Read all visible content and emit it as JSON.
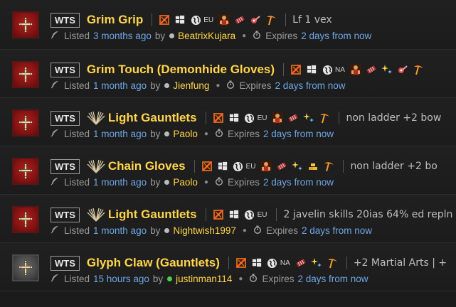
{
  "listings": [
    {
      "badge": "WTS",
      "title": "Grim Grip",
      "has_wings": false,
      "thumb": "red",
      "region": "EU",
      "icons": [
        "ladder-slash-icon",
        "windows-icon",
        "globe-icon",
        "character-icon",
        "ethereal-icon",
        "socket-icon",
        "pickaxe-icon"
      ],
      "note": "Lf 1 vex",
      "listed_label": "Listed",
      "listed_time": "3 months ago",
      "by_label": "by",
      "user": "BeatrixKujara",
      "user_online": false,
      "expires_label": "Expires",
      "expires_time": "2 days from now"
    },
    {
      "badge": "WTS",
      "title": "Grim Touch (Demonhide Gloves)",
      "has_wings": false,
      "thumb": "red",
      "region": "NA",
      "icons": [
        "ladder-slash-icon",
        "windows-icon",
        "globe-icon",
        "character-icon",
        "ethereal-icon",
        "sparkle-icon",
        "socket-icon",
        "pickaxe-icon"
      ],
      "note": "",
      "listed_label": "Listed",
      "listed_time": "1 month ago",
      "by_label": "by",
      "user": "Jienfung",
      "user_online": false,
      "expires_label": "Expires",
      "expires_time": "2 days from now"
    },
    {
      "badge": "WTS",
      "title": "Light Gauntlets",
      "has_wings": true,
      "thumb": "red",
      "region": "EU",
      "icons": [
        "ladder-slash-icon",
        "windows-icon",
        "globe-icon",
        "character-icon",
        "ethereal-icon",
        "sparkle-icon",
        "pickaxe-icon"
      ],
      "note": "non ladder +2 bow",
      "listed_label": "Listed",
      "listed_time": "1 month ago",
      "by_label": "by",
      "user": "Paolo",
      "user_online": false,
      "expires_label": "Expires",
      "expires_time": "2 days from now"
    },
    {
      "badge": "WTS",
      "title": "Chain Gloves",
      "has_wings": true,
      "thumb": "red",
      "region": "EU",
      "icons": [
        "ladder-slash-icon",
        "windows-icon",
        "globe-icon",
        "character-icon",
        "ethereal-icon",
        "sparkle-icon",
        "gold-icon",
        "pickaxe-icon"
      ],
      "note": "non ladder +2 bo",
      "listed_label": "Listed",
      "listed_time": "1 month ago",
      "by_label": "by",
      "user": "Paolo",
      "user_online": false,
      "expires_label": "Expires",
      "expires_time": "2 days from now"
    },
    {
      "badge": "WTS",
      "title": "Light Gauntlets",
      "has_wings": true,
      "thumb": "red",
      "region": "EU",
      "icons": [
        "ladder-slash-icon",
        "windows-icon",
        "globe-icon"
      ],
      "note": "2 javelin skills 20ias 64% ed repln",
      "listed_label": "Listed",
      "listed_time": "1 month ago",
      "by_label": "by",
      "user": "Nightwish1997",
      "user_online": false,
      "expires_label": "Expires",
      "expires_time": "2 days from now"
    },
    {
      "badge": "WTS",
      "title": "Glyph Claw (Gauntlets)",
      "has_wings": false,
      "thumb": "gray",
      "region": "NA",
      "icons": [
        "ladder-slash-icon",
        "windows-icon",
        "globe-icon",
        "ethereal-icon",
        "sparkle-icon",
        "pickaxe-icon"
      ],
      "note": "+2 Martial Arts | +",
      "listed_label": "Listed",
      "listed_time": "15 hours ago",
      "by_label": "by",
      "user": "justinman114",
      "user_online": true,
      "expires_label": "Expires",
      "expires_time": "2 days from now"
    }
  ],
  "colors": {
    "title": "#ffd54a",
    "link": "#6ea6e6",
    "online": "#4bd04b",
    "thumb_red": "#8a1414"
  }
}
